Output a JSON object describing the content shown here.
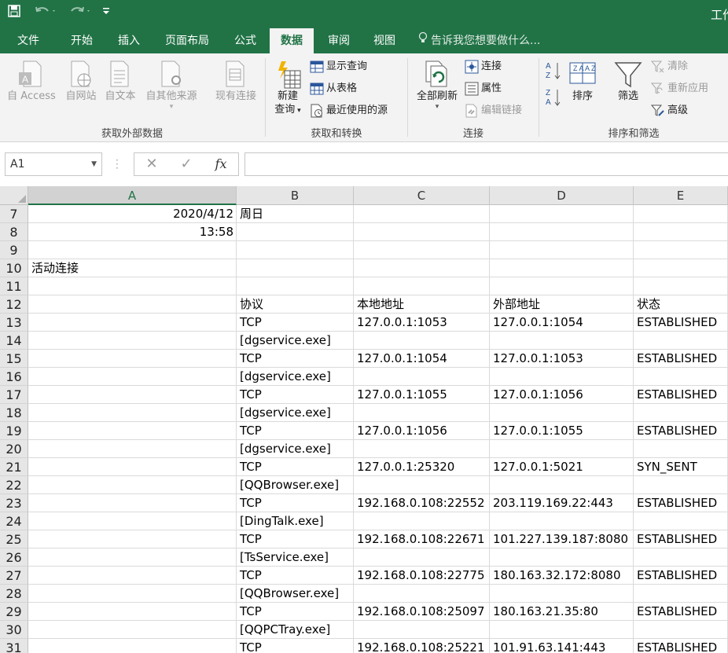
{
  "window": {
    "title": "工作"
  },
  "quick_access": {
    "save_icon": "save-icon",
    "undo_icon": "undo-icon",
    "redo_icon": "redo-icon",
    "customize_icon": "customize-quick-access-icon"
  },
  "tabs": [
    {
      "label": "文件"
    },
    {
      "label": "开始"
    },
    {
      "label": "插入"
    },
    {
      "label": "页面布局"
    },
    {
      "label": "公式"
    },
    {
      "label": "数据",
      "active": true
    },
    {
      "label": "审阅"
    },
    {
      "label": "视图"
    }
  ],
  "tell_me": "告诉我您想要做什么...",
  "ribbon": {
    "external_data": {
      "label": "获取外部数据",
      "buttons": [
        "自 Access",
        "自网站",
        "自文本",
        "自其他来源",
        "现有连接"
      ]
    },
    "get_transform": {
      "label": "获取和转换",
      "new_query": [
        "新建",
        "查询"
      ],
      "show_queries": "显示查询",
      "from_table": "从表格",
      "recent_sources": "最近使用的源"
    },
    "connections": {
      "label": "连接",
      "refresh_all": "全部刷新",
      "connections": "连接",
      "properties": "属性",
      "edit_links": "编辑链接"
    },
    "sort_filter": {
      "label": "排序和筛选",
      "sort": "排序",
      "filter": "筛选",
      "clear": "清除",
      "reapply": "重新应用",
      "advanced": "高级"
    }
  },
  "formula_bar": {
    "name_box": "A1",
    "cancel": "✕",
    "enter": "✓",
    "fx": "fx",
    "value": ""
  },
  "sheet": {
    "columns": [
      "A",
      "B",
      "C",
      "D",
      "E"
    ],
    "selected_column": "A",
    "rows": [
      {
        "num": "7",
        "cells": [
          "2020/4/12",
          "周日",
          "",
          "",
          ""
        ]
      },
      {
        "num": "8",
        "cells": [
          "13:58",
          "",
          "",
          "",
          ""
        ]
      },
      {
        "num": "9",
        "cells": [
          "",
          "",
          "",
          "",
          ""
        ]
      },
      {
        "num": "10",
        "cells": [
          "活动连接",
          "",
          "",
          "",
          ""
        ]
      },
      {
        "num": "11",
        "cells": [
          "",
          "",
          "",
          "",
          ""
        ]
      },
      {
        "num": "12",
        "cells": [
          "",
          "协议",
          "本地地址",
          "外部地址",
          "状态"
        ]
      },
      {
        "num": "13",
        "cells": [
          "",
          "TCP",
          "127.0.0.1:1053",
          "127.0.0.1:1054",
          "ESTABLISHED"
        ]
      },
      {
        "num": "14",
        "cells": [
          "",
          "[dgservice.exe]",
          "",
          "",
          ""
        ]
      },
      {
        "num": "15",
        "cells": [
          "",
          "TCP",
          "127.0.0.1:1054",
          "127.0.0.1:1053",
          "ESTABLISHED"
        ]
      },
      {
        "num": "16",
        "cells": [
          "",
          "[dgservice.exe]",
          "",
          "",
          ""
        ]
      },
      {
        "num": "17",
        "cells": [
          "",
          "TCP",
          "127.0.0.1:1055",
          "127.0.0.1:1056",
          "ESTABLISHED"
        ]
      },
      {
        "num": "18",
        "cells": [
          "",
          "[dgservice.exe]",
          "",
          "",
          ""
        ]
      },
      {
        "num": "19",
        "cells": [
          "",
          "TCP",
          "127.0.0.1:1056",
          "127.0.0.1:1055",
          "ESTABLISHED"
        ]
      },
      {
        "num": "20",
        "cells": [
          "",
          "[dgservice.exe]",
          "",
          "",
          ""
        ]
      },
      {
        "num": "21",
        "cells": [
          "",
          "TCP",
          "127.0.0.1:25320",
          "127.0.0.1:5021",
          "SYN_SENT"
        ]
      },
      {
        "num": "22",
        "cells": [
          "",
          "[QQBrowser.exe]",
          "",
          "",
          ""
        ]
      },
      {
        "num": "23",
        "cells": [
          "",
          "TCP",
          "192.168.0.108:22552",
          "203.119.169.22:443",
          "ESTABLISHED"
        ]
      },
      {
        "num": "24",
        "cells": [
          "",
          "[DingTalk.exe]",
          "",
          "",
          ""
        ]
      },
      {
        "num": "25",
        "cells": [
          "",
          "TCP",
          "192.168.0.108:22671",
          "101.227.139.187:8080",
          "ESTABLISHED"
        ]
      },
      {
        "num": "26",
        "cells": [
          "",
          "[TsService.exe]",
          "",
          "",
          ""
        ]
      },
      {
        "num": "27",
        "cells": [
          "",
          "TCP",
          "192.168.0.108:22775",
          "180.163.32.172:8080",
          "ESTABLISHED"
        ]
      },
      {
        "num": "28",
        "cells": [
          "",
          "[QQBrowser.exe]",
          "",
          "",
          ""
        ]
      },
      {
        "num": "29",
        "cells": [
          "",
          "TCP",
          "192.168.0.108:25097",
          "180.163.21.35:80",
          "ESTABLISHED"
        ]
      },
      {
        "num": "30",
        "cells": [
          "",
          "[QQPCTray.exe]",
          "",
          "",
          ""
        ]
      },
      {
        "num": "31",
        "cells": [
          "",
          "TCP",
          "192.168.0.108:25221",
          "101.91.63.141:443",
          "ESTABLISHED"
        ]
      }
    ]
  },
  "colors": {
    "accent": "#217346",
    "ribbon_bg": "#f3f3f3"
  }
}
